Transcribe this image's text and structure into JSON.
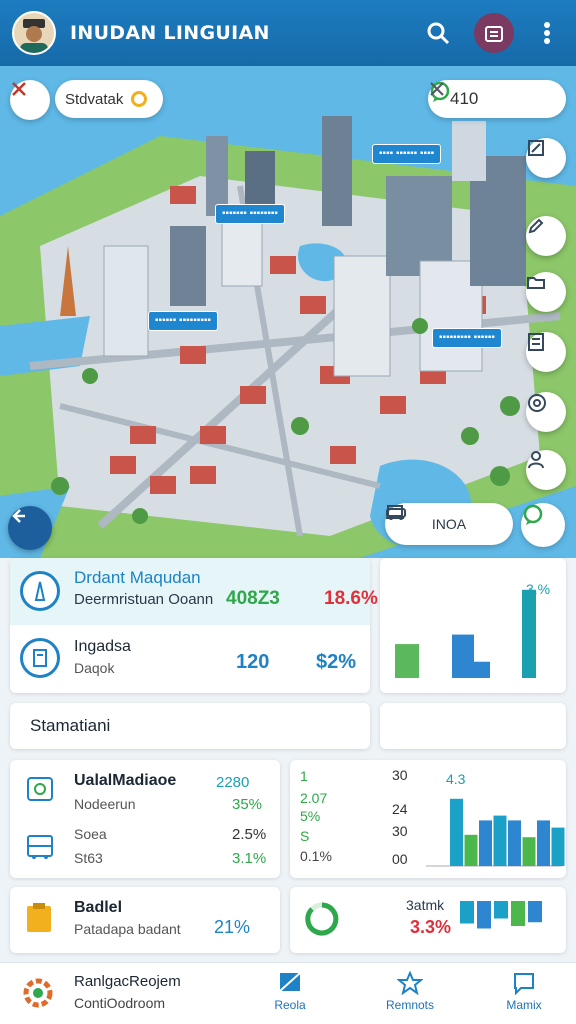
{
  "header": {
    "title": "INUDAN LINGUIAN",
    "icons": [
      "avatar",
      "search-icon",
      "calendar-icon",
      "more-vert-icon"
    ]
  },
  "map": {
    "search_chip": {
      "label": "Stdvatak"
    },
    "counter_chip": {
      "value": "410"
    },
    "labels": [
      {
        "text": "▪▪▪▪ ▪▪▪▪▪▪ ▪▪▪▪"
      },
      {
        "text": "▪▪▪▪▪▪▪ ▪▪▪▪▪▪▪▪"
      },
      {
        "text": "▪▪▪▪▪▪ ▪▪▪▪▪▪▪▪▪"
      },
      {
        "text": "▪▪▪▪▪▪▪▪▪ ▪▪▪▪▪▪"
      }
    ],
    "mode_pill": {
      "label": "INOA"
    },
    "side_icons": [
      "edit-icon",
      "pencil-icon",
      "folder-icon",
      "list-icon",
      "compass-icon",
      "person-icon"
    ]
  },
  "overview": {
    "row1": {
      "title": "Drdant Maqudan",
      "sub": "Deermristuan Ooann",
      "value1": "408Z3",
      "value2": "18.6%"
    },
    "row2": {
      "title": "Ingadsa",
      "sub": "Daqok",
      "value1": "120",
      "value2": "$2%"
    },
    "chart": {
      "label": "3.%"
    }
  },
  "section": {
    "title": "Stamatiani"
  },
  "stats": {
    "title": "UalalMadiaoe",
    "title_value": "2280",
    "rows": [
      {
        "label": "Nodeerun",
        "value": "35%"
      },
      {
        "label": "Soea",
        "value": "2.5%"
      },
      {
        "label": "St63",
        "value": "3.1%"
      }
    ],
    "mini_labels": [
      "1",
      "2.07",
      "5%",
      "S",
      "0.1%"
    ],
    "axis": [
      "30",
      "24",
      "30",
      "00"
    ],
    "chart_title": "4.3"
  },
  "badge_card": {
    "title": "Badlel",
    "sub": "Patadapa badant",
    "value": "21%"
  },
  "gauge_card": {
    "title": "3atmk",
    "value": "3.3%"
  },
  "bottom_nav": {
    "profile_title": "RanlgacReojem",
    "profile_sub": "ContiOodroom",
    "items": [
      {
        "label": "Reola"
      },
      {
        "label": "Remnots"
      },
      {
        "label": "Mamix"
      }
    ]
  },
  "chart_data": [
    {
      "type": "bar",
      "title": "",
      "data_label": "3.%",
      "series": [
        {
          "values": [
            25,
            32,
            12,
            65
          ]
        }
      ],
      "colors": [
        "#5cb85c",
        "#2f86d0",
        "#2f86d0",
        "#1ba0b0"
      ]
    },
    {
      "type": "bar",
      "title": "4.3",
      "ylim": [
        0,
        30
      ],
      "series": [
        {
          "values": [
            28,
            13,
            19,
            21,
            19,
            12,
            19,
            16,
            12
          ]
        }
      ],
      "colors": [
        "#1ba0c8",
        "#4cb84c",
        "#2f86d0",
        "#1ba0c8",
        "#2f86d0",
        "#4cb84c",
        "#2f86d0",
        "#1ba0c8",
        "#4cb84c"
      ]
    },
    {
      "type": "bar",
      "title": "3atmk",
      "series": [
        {
          "values": [
            18,
            22,
            14,
            20,
            17
          ]
        }
      ],
      "colors": [
        "#1ba0c8",
        "#2f86d0",
        "#1ba0c8",
        "#4cb84c",
        "#2f86d0"
      ]
    }
  ]
}
